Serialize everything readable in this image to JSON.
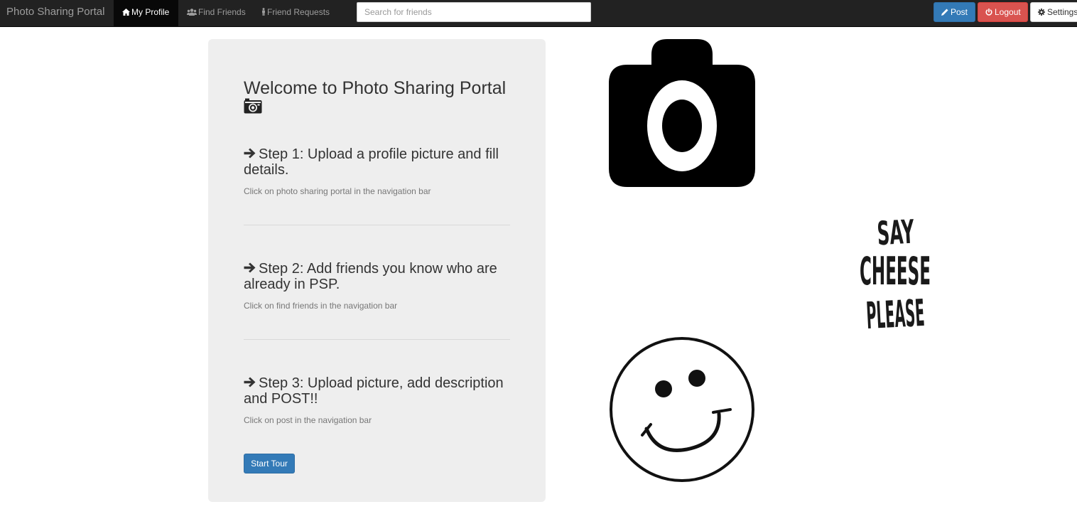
{
  "navbar": {
    "brand": "Photo Sharing Portal",
    "items": [
      {
        "label": "My Profile",
        "icon": "home-icon",
        "active": true
      },
      {
        "label": "Find Friends",
        "icon": "users-icon",
        "active": false
      },
      {
        "label": "Friend Requests",
        "icon": "user-icon",
        "active": false
      }
    ],
    "search_placeholder": "Search for friends",
    "buttons": {
      "post": {
        "label": "Post",
        "icon": "pencil-icon",
        "color": "#337ab7"
      },
      "logout": {
        "label": "Logout",
        "icon": "power-icon",
        "color": "#d9534f"
      },
      "settings": {
        "label": "Settings",
        "icon": "gear-icon"
      }
    }
  },
  "welcome": {
    "title": "Welcome to Photo Sharing Portal",
    "title_icon": "camera-icon",
    "steps": [
      {
        "heading": "Step 1: Upload a profile picture and fill details.",
        "description": "Click on photo sharing portal in the navigation bar",
        "icon": "arrow-right-icon"
      },
      {
        "heading": "Step 2: Add friends you know who are already in PSP.",
        "description": "Click on find friends in the navigation bar",
        "icon": "arrow-right-icon"
      },
      {
        "heading": "Step 3: Upload picture, add description and POST!!",
        "description": "Click on post in the navigation bar",
        "icon": "arrow-right-icon"
      }
    ],
    "tour_button": "Start Tour"
  },
  "images": {
    "camera": "camera-image",
    "say_cheese": {
      "name": "say-cheese-please-image",
      "lines": [
        "SAY",
        "CHEESE",
        "PLEASE"
      ]
    },
    "smiley": "smiley-face-image"
  }
}
